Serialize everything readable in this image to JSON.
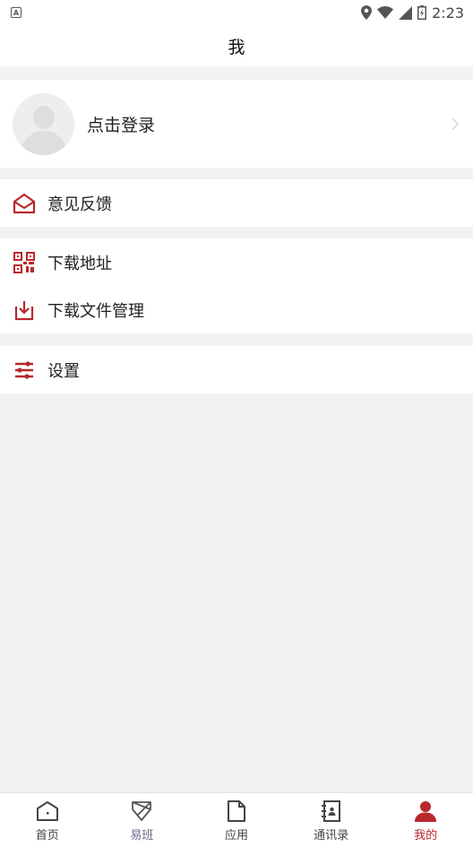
{
  "status_bar": {
    "time": "2:23"
  },
  "header": {
    "title": "我"
  },
  "login": {
    "label": "点击登录"
  },
  "menu_groups": [
    {
      "items": [
        {
          "label": "意见反馈",
          "icon": "mail-open-icon"
        }
      ]
    },
    {
      "items": [
        {
          "label": "下载地址",
          "icon": "qr-code-icon"
        },
        {
          "label": "下载文件管理",
          "icon": "download-icon"
        }
      ]
    },
    {
      "items": [
        {
          "label": "设置",
          "icon": "sliders-icon"
        }
      ]
    }
  ],
  "tabbar": {
    "tabs": [
      {
        "label": "首页",
        "icon": "home-icon"
      },
      {
        "label": "易班",
        "icon": "yiban-icon"
      },
      {
        "label": "应用",
        "icon": "document-icon"
      },
      {
        "label": "通讯录",
        "icon": "contacts-icon"
      },
      {
        "label": "我的",
        "icon": "person-icon",
        "active": true
      }
    ]
  },
  "colors": {
    "accent": "#b8282c",
    "background": "#f2f2f2",
    "card": "#ffffff"
  }
}
